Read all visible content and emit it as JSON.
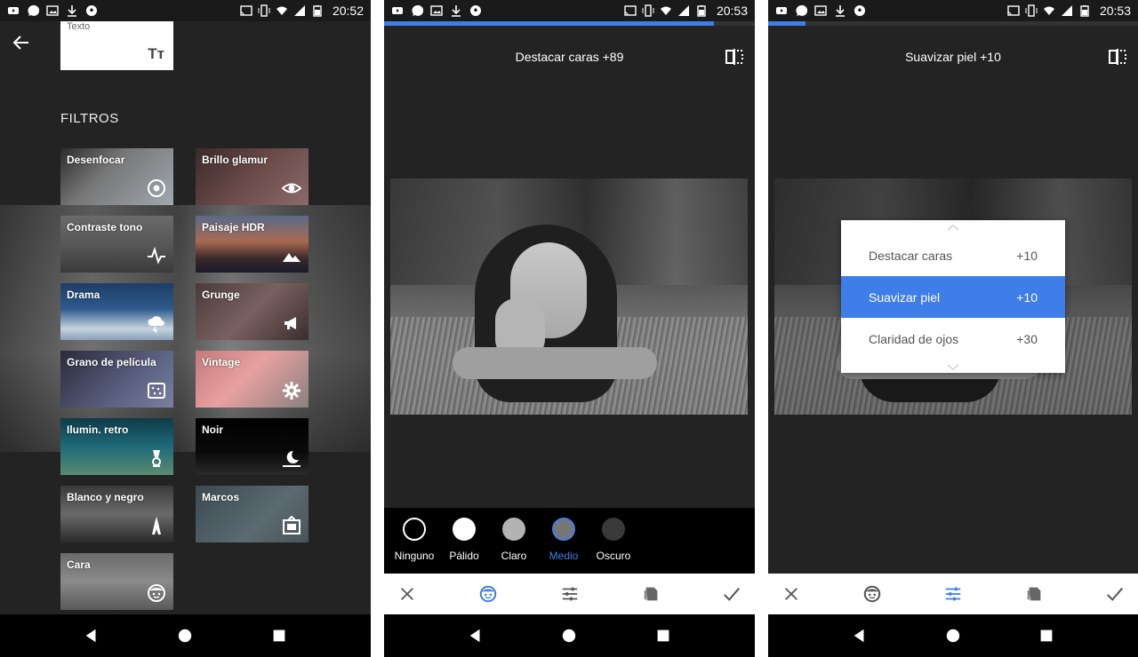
{
  "colors": {
    "accent": "#3f7ee8",
    "panel_bg": "#232323",
    "toolbar_bg": "#ffffff"
  },
  "status_left_icons": [
    "youtube-icon",
    "messenger-icon",
    "gallery-icon",
    "download-icon",
    "soccer-icon"
  ],
  "screen1": {
    "clock": "20:52",
    "texto_label": "Texto",
    "texto_icon": "Tт",
    "section_title": "FILTROS",
    "filters": [
      {
        "label": "Desenfocar",
        "icon": "target-icon"
      },
      {
        "label": "Brillo glamur",
        "icon": "eye-icon"
      },
      {
        "label": "Contraste tono",
        "icon": "pulse-icon"
      },
      {
        "label": "Paisaje HDR",
        "icon": "mountain-icon"
      },
      {
        "label": "Drama",
        "icon": "storm-cloud-icon"
      },
      {
        "label": "Grunge",
        "icon": "megaphone-icon"
      },
      {
        "label": "Grano de película",
        "icon": "film-grain-icon"
      },
      {
        "label": "Vintage",
        "icon": "flower-icon"
      },
      {
        "label": "Ilumin. retro",
        "icon": "lamp-icon"
      },
      {
        "label": "Noir",
        "icon": "moon-icon"
      },
      {
        "label": "Blanco y negro",
        "icon": "eiffel-tower-icon"
      },
      {
        "label": "Marcos",
        "icon": "frame-icon"
      },
      {
        "label": "Cara",
        "icon": "face-icon"
      }
    ]
  },
  "screen2": {
    "clock": "20:53",
    "title": "Destacar caras +89",
    "progress": 0.89,
    "skin_tones": [
      {
        "name": "Ninguno",
        "color": "#000000"
      },
      {
        "name": "Pálido",
        "color": "#ffffff"
      },
      {
        "name": "Claro",
        "color": "#b3b3b3"
      },
      {
        "name": "Medio",
        "color": "#777777"
      },
      {
        "name": "Oscuro",
        "color": "#3a3a3a"
      }
    ],
    "selected_skin": "Medio"
  },
  "screen3": {
    "clock": "20:53",
    "title": "Suavizar piel +10",
    "progress": 0.1,
    "menu": [
      {
        "label": "Destacar caras",
        "value": "+10"
      },
      {
        "label": "Suavizar piel",
        "value": "+10"
      },
      {
        "label": "Claridad de ojos",
        "value": "+30"
      }
    ],
    "selected_menu": "Suavizar piel"
  }
}
